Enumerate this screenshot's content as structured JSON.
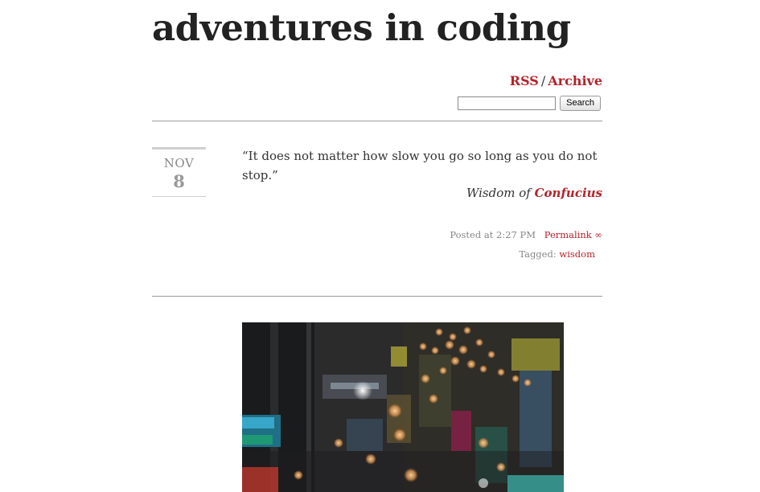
{
  "site": {
    "title": "adventures in coding"
  },
  "nav": {
    "rss": "RSS",
    "separator": "/",
    "archive": "Archive"
  },
  "search": {
    "input_value": "",
    "button": "Search"
  },
  "post1": {
    "date": {
      "month": "NOV",
      "day": "8"
    },
    "quote": "“It does not matter how slow you go so long as you do not stop.”",
    "source_prefix": "Wisdom of",
    "source_name": "Confucius",
    "posted": "Posted at 2:27 PM",
    "permalink": "Permalink ∞",
    "tagged_label": "Tagged:",
    "tag": "wisdom"
  },
  "post2": {
    "photo": "night-street-bokeh-photo"
  },
  "colors": {
    "accent": "#b5232a",
    "text": "#222222",
    "muted": "#888888",
    "rule": "#9e9e9e"
  }
}
